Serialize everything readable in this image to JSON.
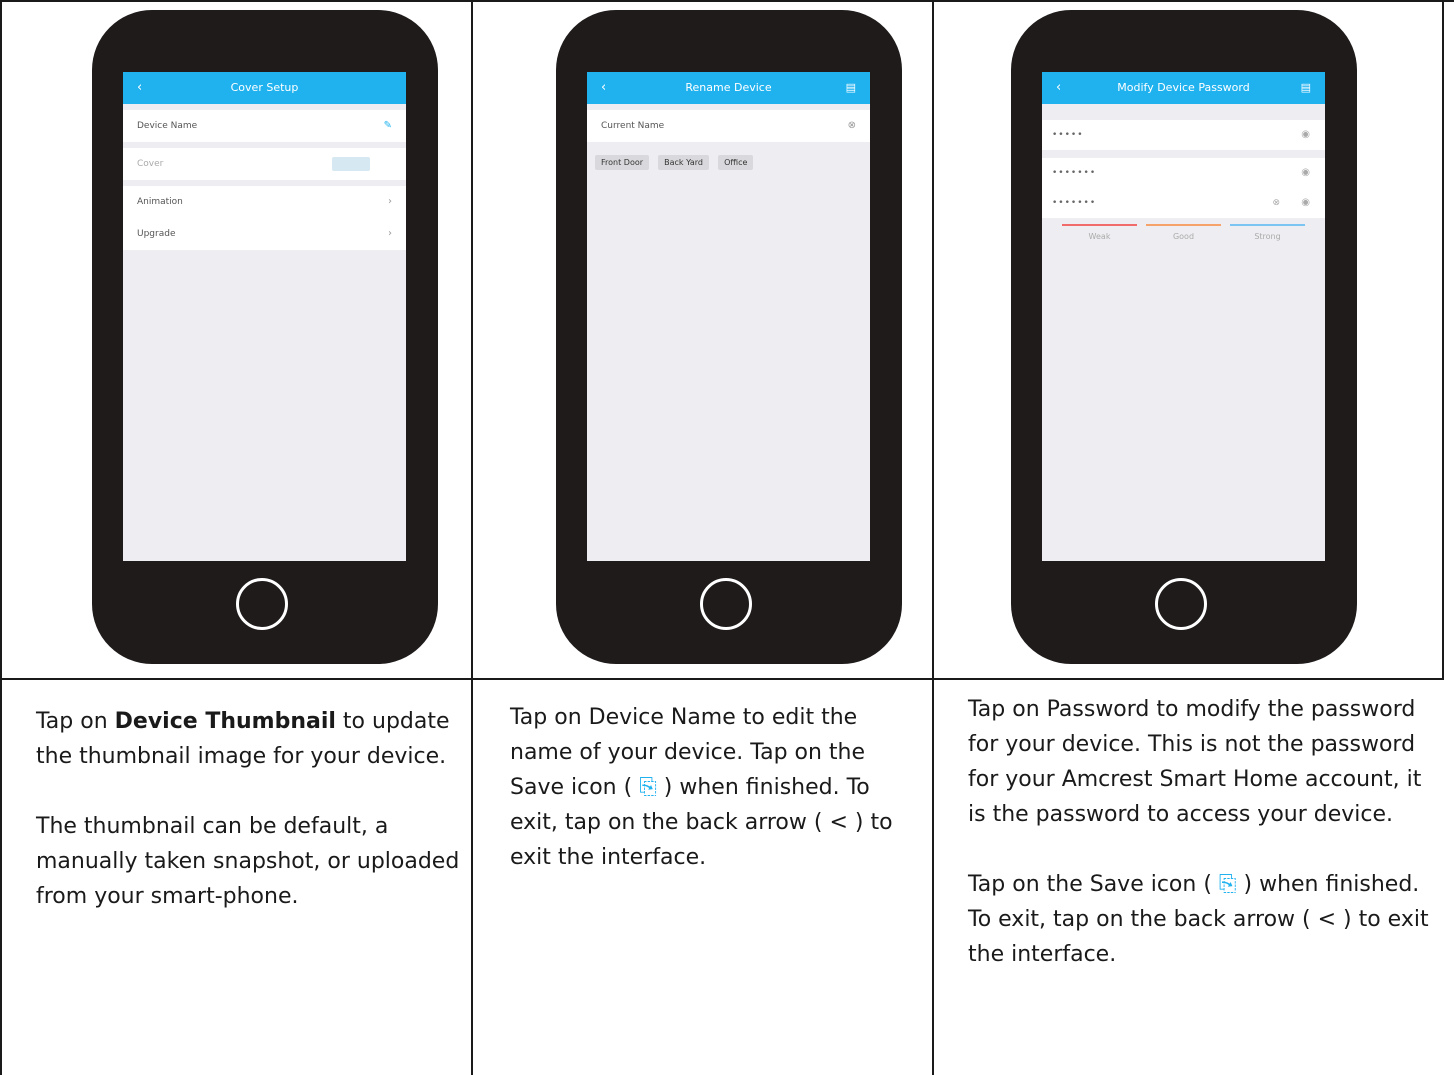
{
  "panels": [
    {
      "screen": {
        "title": "Cover Setup",
        "rows": [
          "Device Name",
          "Cover",
          "Animation",
          "Upgrade"
        ]
      },
      "caption": {
        "p1_prefix": "Tap on ",
        "p1_bold": "Device Thumbnail",
        "p1_suffix": " to update the thumbnail image for your device.",
        "p2": "The thumbnail can be default, a manually taken snapshot, or uploaded from your smart-phone."
      }
    },
    {
      "screen": {
        "title": "Rename Device",
        "field_value": "Current Name",
        "chips": [
          "Front Door",
          "Back Yard",
          "Office"
        ]
      },
      "caption": {
        "p1_a": "Tap on Device Name to edit the name of your device. Tap on the Save icon ( ",
        "p1_b": " ) when finished. To exit, tap on the back arrow ( < ) to exit the interface."
      }
    },
    {
      "screen": {
        "title": "Modify Device Password",
        "fields": [
          "•••••",
          "•••••••",
          "•••••••"
        ],
        "strength": [
          "Weak",
          "Good",
          "Strong"
        ],
        "strength_colors": [
          "#f26b6b",
          "#f5a36b",
          "#7cc4f2"
        ]
      },
      "caption": {
        "p1": "Tap on Password to modify the password for your device. This is not the password for your Amcrest Smart Home account, it is the password to access your device.",
        "p2_a": "Tap on the Save icon ( ",
        "p2_b": " ) when finished. To exit, tap on the back arrow ( < ) to exit the interface."
      }
    }
  ],
  "icons": {
    "back": "‹",
    "save": "▤",
    "edit": "✎",
    "chevron": "›",
    "eye": "◉",
    "clear": "⊗",
    "save_glyph": "⎘"
  }
}
